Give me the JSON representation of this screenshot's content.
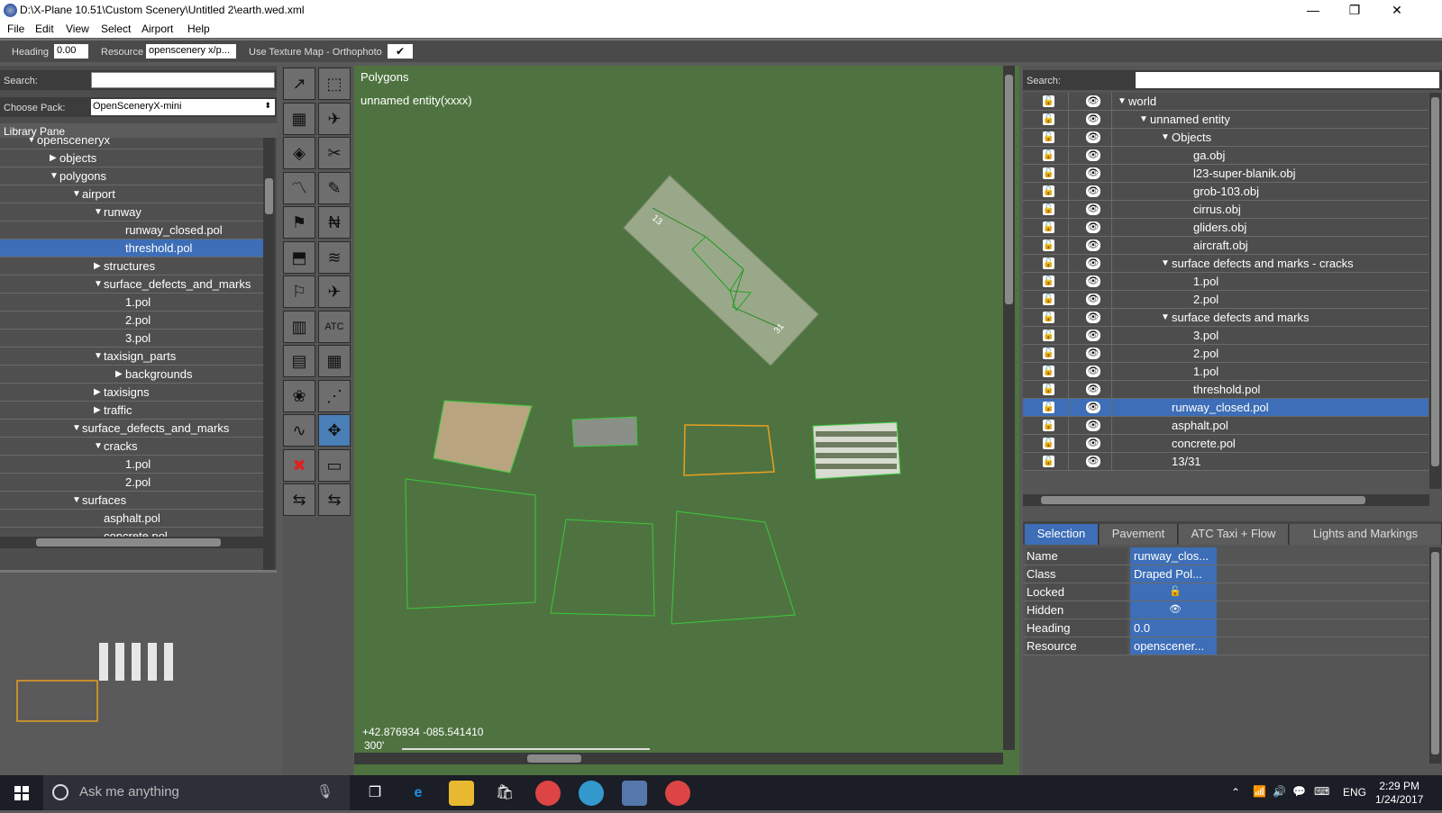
{
  "window": {
    "title": "D:\\X-Plane 10.51\\Custom Scenery\\Untitled 2\\earth.wed.xml",
    "minimize": "—",
    "restore": "❐",
    "close": "✕"
  },
  "menu": [
    "File",
    "Edit",
    "View",
    "Select",
    "Airport",
    "Help"
  ],
  "toolbar": {
    "heading_label": "Heading",
    "heading_value": "0.00",
    "resource_label": "Resource",
    "resource_value": "openscenery x/p...",
    "texture_label": "Use Texture Map - Orthophoto",
    "texture_check": "✔"
  },
  "library": {
    "search_label": "Search:",
    "pack_label": "Choose Pack:",
    "pack_value": "OpenSceneryX-mini",
    "pane_title": "Library Pane",
    "rows": [
      {
        "label": "opensceneryx",
        "tri": "▼",
        "indent": 1,
        "selected": false
      },
      {
        "label": "objects",
        "tri": "▶",
        "indent": 2,
        "selected": false
      },
      {
        "label": "polygons",
        "tri": "▼",
        "indent": 2,
        "selected": false
      },
      {
        "label": "airport",
        "tri": "▼",
        "indent": 3,
        "selected": false
      },
      {
        "label": "runway",
        "tri": "▼",
        "indent": 4,
        "selected": false
      },
      {
        "label": "runway_closed.pol",
        "tri": "",
        "indent": 5,
        "selected": false
      },
      {
        "label": "threshold.pol",
        "tri": "",
        "indent": 5,
        "selected": true
      },
      {
        "label": "structures",
        "tri": "▶",
        "indent": 4,
        "selected": false
      },
      {
        "label": "surface_defects_and_marks",
        "tri": "▼",
        "indent": 4,
        "selected": false
      },
      {
        "label": "1.pol",
        "tri": "",
        "indent": 5,
        "selected": false
      },
      {
        "label": "2.pol",
        "tri": "",
        "indent": 5,
        "selected": false
      },
      {
        "label": "3.pol",
        "tri": "",
        "indent": 5,
        "selected": false
      },
      {
        "label": "taxisign_parts",
        "tri": "▼",
        "indent": 4,
        "selected": false
      },
      {
        "label": "backgrounds",
        "tri": "▶",
        "indent": 5,
        "selected": false
      },
      {
        "label": "taxisigns",
        "tri": "▶",
        "indent": 4,
        "selected": false
      },
      {
        "label": "traffic",
        "tri": "▶",
        "indent": 4,
        "selected": false
      },
      {
        "label": "surface_defects_and_marks",
        "tri": "▼",
        "indent": 3,
        "selected": false
      },
      {
        "label": "cracks",
        "tri": "▼",
        "indent": 4,
        "selected": false
      },
      {
        "label": "1.pol",
        "tri": "",
        "indent": 5,
        "selected": false
      },
      {
        "label": "2.pol",
        "tri": "",
        "indent": 5,
        "selected": false
      },
      {
        "label": "surfaces",
        "tri": "▼",
        "indent": 3,
        "selected": false
      },
      {
        "label": "asphalt.pol",
        "tri": "",
        "indent": 4,
        "selected": false
      },
      {
        "label": "concrete.pol",
        "tri": "",
        "indent": 4,
        "selected": false
      }
    ]
  },
  "map": {
    "mode_title": "Polygons",
    "entity": "unnamed entity(xxxx)",
    "coords": "+42.876934 -085.541410",
    "scale": "300'",
    "runway_end_a": "13",
    "runway_end_b": "31"
  },
  "tools": [
    "↗",
    "⬚",
    "▦",
    "✈",
    "◈",
    "✂",
    "〽",
    "✎",
    "⚑",
    "₦",
    "⬒",
    "≋",
    "⚐",
    "✈",
    "▥",
    "ATC",
    "▤",
    "▦",
    "❀",
    "⋰",
    "∿",
    "✥",
    "✖",
    "▭",
    "⇆",
    "⇆"
  ],
  "hierarchy": {
    "search_label": "Search:",
    "rows": [
      {
        "label": "world",
        "tri": "▼",
        "indent": 0,
        "selected": false
      },
      {
        "label": "unnamed entity",
        "tri": "▼",
        "indent": 1,
        "selected": false
      },
      {
        "label": "Objects",
        "tri": "▼",
        "indent": 2,
        "selected": false
      },
      {
        "label": "ga.obj",
        "tri": "",
        "indent": 3,
        "selected": false
      },
      {
        "label": "l23-super-blanik.obj",
        "tri": "",
        "indent": 3,
        "selected": false
      },
      {
        "label": "grob-103.obj",
        "tri": "",
        "indent": 3,
        "selected": false
      },
      {
        "label": "cirrus.obj",
        "tri": "",
        "indent": 3,
        "selected": false
      },
      {
        "label": "gliders.obj",
        "tri": "",
        "indent": 3,
        "selected": false
      },
      {
        "label": "aircraft.obj",
        "tri": "",
        "indent": 3,
        "selected": false
      },
      {
        "label": "surface defects and marks - cracks",
        "tri": "▼",
        "indent": 2,
        "selected": false
      },
      {
        "label": "1.pol",
        "tri": "",
        "indent": 3,
        "selected": false
      },
      {
        "label": "2.pol",
        "tri": "",
        "indent": 3,
        "selected": false
      },
      {
        "label": "surface defects and marks",
        "tri": "▼",
        "indent": 2,
        "selected": false
      },
      {
        "label": "3.pol",
        "tri": "",
        "indent": 3,
        "selected": false
      },
      {
        "label": "2.pol",
        "tri": "",
        "indent": 3,
        "selected": false
      },
      {
        "label": "1.pol",
        "tri": "",
        "indent": 3,
        "selected": false
      },
      {
        "label": "threshold.pol",
        "tri": "",
        "indent": 3,
        "selected": false
      },
      {
        "label": "runway_closed.pol",
        "tri": "",
        "indent": 2,
        "selected": true
      },
      {
        "label": "asphalt.pol",
        "tri": "",
        "indent": 2,
        "selected": false
      },
      {
        "label": "concrete.pol",
        "tri": "",
        "indent": 2,
        "selected": false
      },
      {
        "label": "13/31",
        "tri": "",
        "indent": 2,
        "selected": false
      }
    ]
  },
  "tabs": [
    "Selection",
    "Pavement",
    "ATC Taxi + Flow",
    "Lights and Markings"
  ],
  "properties": [
    {
      "key": "Name",
      "value": "runway_clos..."
    },
    {
      "key": "Class",
      "value": "Draped Pol..."
    },
    {
      "key": "Locked",
      "value": "🔓"
    },
    {
      "key": "Hidden",
      "value": "👁"
    },
    {
      "key": "Heading",
      "value": "0.0"
    },
    {
      "key": "Resource",
      "value": "openscener..."
    }
  ],
  "taskbar": {
    "search_placeholder": "Ask me anything",
    "lang": "ENG",
    "time": "2:29 PM",
    "date": "1/24/2017"
  },
  "colors": {
    "selection": "#3d6eb7",
    "map_green": "#4f7340",
    "accent_orange": "#e8a020"
  }
}
